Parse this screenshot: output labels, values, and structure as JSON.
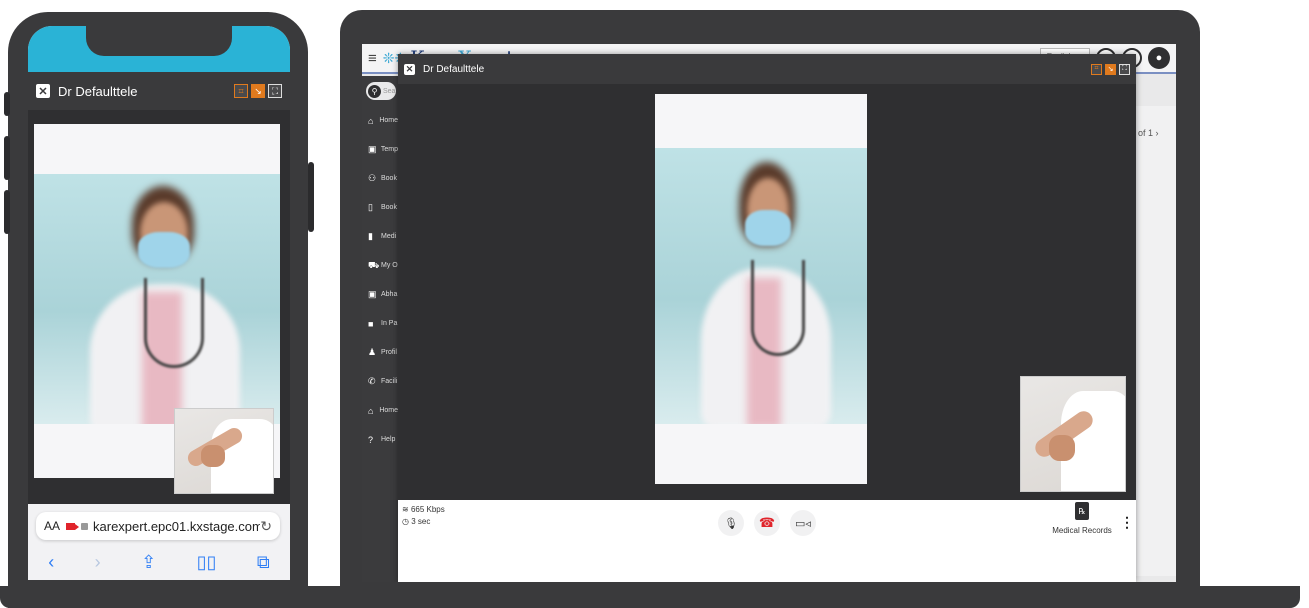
{
  "phone": {
    "call_title": "Dr Defaulttele",
    "close_glyph": "✕",
    "window_controls": [
      "⌗",
      "↘",
      "⛶"
    ],
    "browser": {
      "text_size_label": "AA",
      "url": "karexpert.epc01.kxstage.com",
      "reload_glyph": "↻",
      "nav": {
        "back": "‹",
        "forward": "›",
        "share": "⇪",
        "bookmarks": "▯▯",
        "tabs": "⧉"
      }
    }
  },
  "laptop": {
    "app": {
      "logo_prefix": "Kare",
      "logo_x": "X",
      "logo_suffix": "pert",
      "logo_mark": "❊❊",
      "menu_glyph": "≡",
      "language": "English",
      "icons": {
        "notifications": "⍾",
        "group": "☺",
        "profile": "●"
      }
    },
    "sidebar": {
      "search_placeholder": "Sea",
      "items": [
        {
          "label": "Home",
          "icon": "⌂"
        },
        {
          "label": "Temp",
          "icon": "▣"
        },
        {
          "label": "Book",
          "icon": "⚇"
        },
        {
          "label": "Book",
          "icon": "▯"
        },
        {
          "label": "Medi",
          "icon": "▮"
        },
        {
          "label": "My O",
          "icon": "⛟"
        },
        {
          "label": "Abha",
          "icon": "▣"
        },
        {
          "label": "In Pa",
          "icon": "■"
        },
        {
          "label": "Profil",
          "icon": "♟"
        },
        {
          "label": "Facili",
          "icon": "✆"
        },
        {
          "label": "Home",
          "icon": "⌂"
        },
        {
          "label": "Help",
          "icon": "?"
        }
      ]
    },
    "pager_text": "of 1  ›",
    "call": {
      "title": "Dr Defaulttele",
      "bandwidth": "665 Kbps",
      "duration": "3 sec",
      "controls": {
        "mic": "🎙",
        "hangup": "☎",
        "camera": "▭◃"
      },
      "medical_records_label": "Medical Records",
      "rx_glyph": "℞",
      "more_glyph": "⋮"
    }
  }
}
